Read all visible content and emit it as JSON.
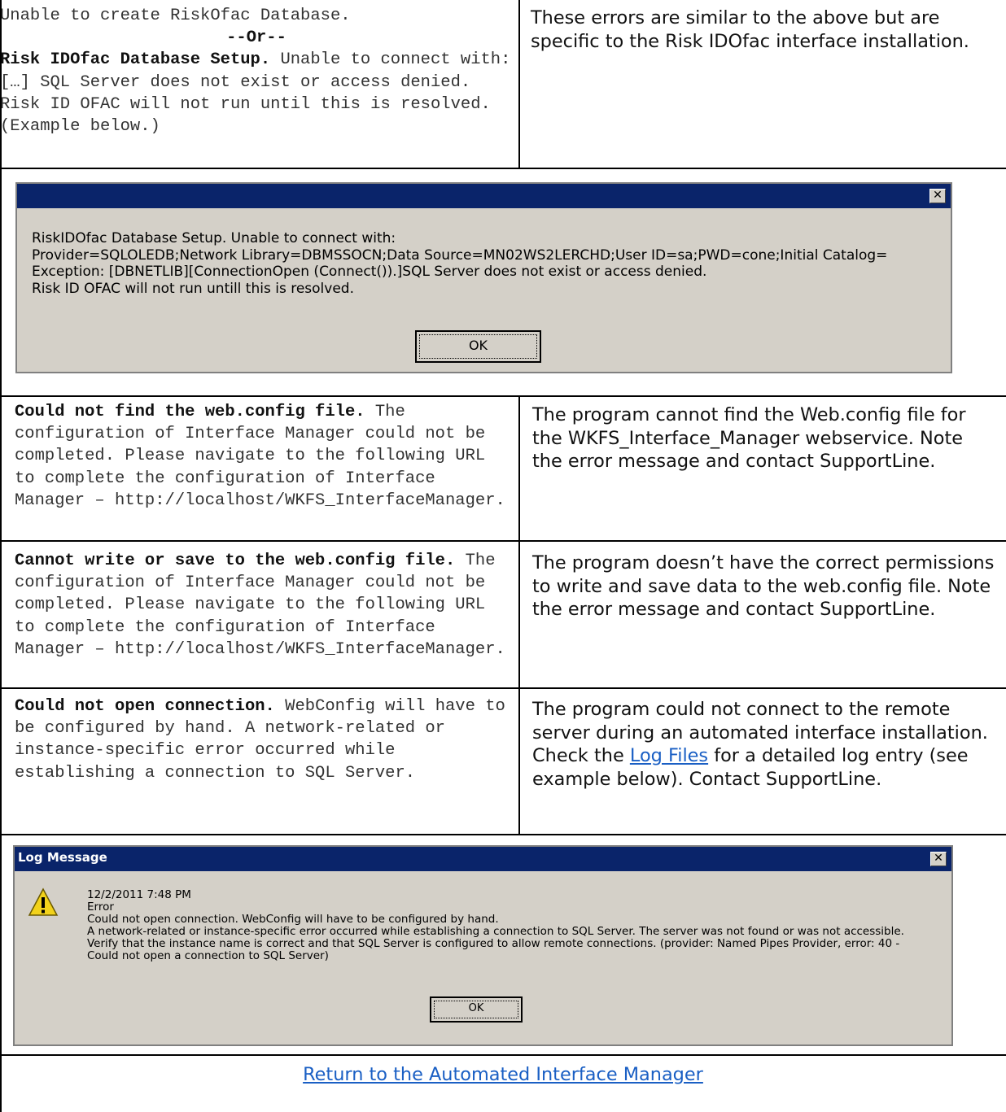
{
  "rows": {
    "r1": {
      "left_line1": "Unable to create RiskOfac Database.",
      "left_or": "--Or--",
      "left_bold": "Risk IDOfac Database Setup.",
      "left_rest": " Unable to connect with: […] SQL Server does not exist or access denied. Risk ID OFAC will not run until this is resolved. (Example below.)",
      "right": "These errors are similar to the above but are specific to the Risk IDOfac interface installation."
    },
    "dialog1": {
      "title": "",
      "close_label": "✕",
      "lines": [
        "RiskIDOfac Database Setup.  Unable to connect with:",
        "Provider=SQLOLEDB;Network Library=DBMSSOCN;Data Source=MN02WS2LERCHD;User ID=sa;PWD=cone;Initial Catalog=",
        "Exception: [DBNETLIB][ConnectionOpen (Connect()).]SQL Server does not exist or access denied.",
        "Risk ID OFAC will not run untill this is resolved."
      ],
      "ok_label": "OK"
    },
    "r2": {
      "left_bold": "Could not find the web.config file.",
      "left_rest": " The configuration of Interface Manager could not be completed. Please navigate to the following URL to complete the configuration of Interface Manager – http://localhost/WKFS_InterfaceManager.",
      "right": "The program cannot find the Web.config file for the WKFS_Interface_Manager webservice. Note the error message and contact SupportLine."
    },
    "r3": {
      "left_bold": "Cannot write or save to the web.config file.",
      "left_rest": " The configuration of Interface Manager could not be completed. Please navigate to the following URL to complete the configuration of Interface Manager – http://localhost/WKFS_InterfaceManager.",
      "right": "The program doesn’t have the correct permissions to write and save data to the web.config file. Note the error message and contact SupportLine."
    },
    "r4": {
      "left_bold": "Could not open connection.",
      "left_rest": " WebConfig will have to be configured by hand. A network-related or instance-specific error occurred while establishing a connection to SQL Server.",
      "right_before": "The program could not connect to the remote server during an automated interface installation. Check the ",
      "right_link": "Log Files",
      "right_after": " for a detailed log entry (see example below). Contact SupportLine."
    },
    "dialog2": {
      "title": "Log Message",
      "close_label": "✕",
      "icon": "warning-icon",
      "lines": [
        "12/2/2011  7:48 PM",
        "Error",
        "Could not open connection.  WebConfig will have to be configured by hand.",
        "A network-related or instance-specific error occurred while establishing a connection to SQL Server. The server was not found or was not accessible.",
        "Verify that the instance name is correct and that SQL Server is configured to allow remote connections. (provider: Named Pipes Provider, error: 40 -",
        "Could not open a connection to SQL Server)"
      ],
      "ok_label": "OK"
    },
    "footer": {
      "link": "Return to the Automated Interface Manager"
    }
  }
}
